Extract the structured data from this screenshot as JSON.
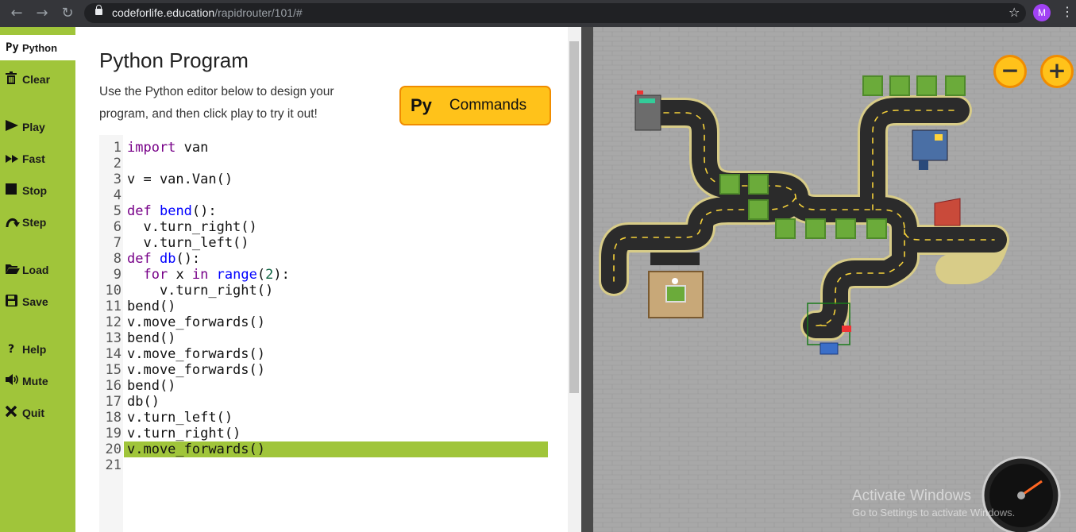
{
  "browser": {
    "url_host": "codeforlife.education",
    "url_path": "/rapidrouter/101/#",
    "avatar_letter": "M"
  },
  "sidebar": {
    "items": [
      {
        "icon": "Py",
        "label": "Python"
      },
      {
        "icon": "clear-icon",
        "label": "Clear"
      },
      {
        "icon": "play-icon",
        "label": "Play"
      },
      {
        "icon": "fast-icon",
        "label": "Fast"
      },
      {
        "icon": "stop-icon",
        "label": "Stop"
      },
      {
        "icon": "step-icon",
        "label": "Step"
      },
      {
        "icon": "load-icon",
        "label": "Load"
      },
      {
        "icon": "save-icon",
        "label": "Save"
      },
      {
        "icon": "help-icon",
        "label": "Help"
      },
      {
        "icon": "mute-icon",
        "label": "Mute"
      },
      {
        "icon": "quit-icon",
        "label": "Quit"
      }
    ]
  },
  "main": {
    "title": "Python Program",
    "description": "Use the Python editor below to design your program, and then click play to try it out!",
    "commands_button": {
      "icon": "Py",
      "label": "Commands"
    }
  },
  "editor": {
    "active_line": 20,
    "lines": [
      "import van",
      "",
      "v = van.Van()",
      "",
      "def bend():",
      "  v.turn_right()",
      "  v.turn_left()",
      "def db():",
      "  for x in range(2):",
      "    v.turn_right()",
      "bend()",
      "v.move_forwards()",
      "bend()",
      "v.move_forwards()",
      "v.move_forwards()",
      "bend()",
      "db()",
      "v.turn_left()",
      "v.turn_right()",
      "v.move_forwards()",
      ""
    ]
  },
  "map": {
    "zoom_out": "−",
    "zoom_in": "+",
    "watermark_title": "Activate Windows",
    "watermark_sub": "Go to Settings to activate Windows."
  },
  "colors": {
    "sidebar": "#a0c53a",
    "accent": "#ffc21a",
    "accent_border": "#f08c00",
    "map_bg": "#aaaaaa"
  }
}
